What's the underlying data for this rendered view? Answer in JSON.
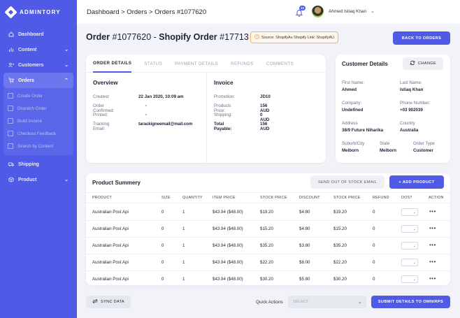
{
  "brand": {
    "name": "ADMINTORY"
  },
  "sidebar": {
    "items": [
      {
        "label": "Dashboard",
        "icon": "home-icon"
      },
      {
        "label": "Content",
        "icon": "bar-chart-icon"
      },
      {
        "label": "Customers",
        "icon": "users-icon"
      },
      {
        "label": "Orders",
        "icon": "cart-icon"
      },
      {
        "label": "Shipping",
        "icon": "truck-icon"
      },
      {
        "label": "Product",
        "icon": "box-icon"
      }
    ],
    "order_sub": [
      "Create Order",
      "Dispatch Order",
      "Build Invoice",
      "Checkout Feedback",
      "Search by Content"
    ]
  },
  "topbar": {
    "breadcrumb": "Dashboard > Orders > Orders #1077620",
    "notification_count": "12",
    "username": "Ahmed Istiaq Khan"
  },
  "header": {
    "title_prefix": "Order",
    "order_id": "#1077620",
    "sep": "-",
    "shopify_label": "Shopify Order",
    "shopify_id": "#17713",
    "source": "Source: ShopifyAu Shopify Link: ShopifyAU",
    "back_label": "BACK TO ORDERS"
  },
  "order_tabs": [
    "ORDER DETAILS",
    "STATUS",
    "PAYMENT DETAILS",
    "REFUNDS",
    "COMMENTS"
  ],
  "overview": {
    "title": "Overview",
    "rows": [
      {
        "k": "Created:",
        "v": "22 Jan 2020, 10:09 am"
      },
      {
        "k": "Order Confirmed:",
        "v": "-"
      },
      {
        "k": "Printed:",
        "v": "-"
      },
      {
        "k": "Tracking Email:",
        "v": "tarackigneemail@mail.com"
      }
    ]
  },
  "invoice": {
    "title": "Invoice",
    "rows": [
      {
        "k": "Promotion:",
        "v": "JD10"
      },
      {
        "k": "Products Price:",
        "v": "156 AUD"
      },
      {
        "k": "Shipping:",
        "v": "0 AUD"
      },
      {
        "k": "Total Payable:",
        "v": "156 AUD"
      }
    ]
  },
  "customer": {
    "title": "Customer Details",
    "change_label": "CHANGE",
    "first_name": {
      "label": "First Name:",
      "value": "Ahmed"
    },
    "last_name": {
      "label": "Last Name:",
      "value": "Istiaq Khan"
    },
    "company": {
      "label": "Company:",
      "value": "Undefined"
    },
    "phone": {
      "label": "Phone Number:",
      "value": "+03 902039"
    },
    "address": {
      "label": "Address",
      "value": "38/9 Future Niharika"
    },
    "country": {
      "label": "Country",
      "value": "Australia"
    },
    "suburb": {
      "label": "Suburb/City",
      "value": "Melborn"
    },
    "state": {
      "label": "State",
      "value": "Melborn"
    },
    "order_type": {
      "label": "Order Type",
      "value": "Customer"
    }
  },
  "products": {
    "title": "Product Summery",
    "stock_email_label": "SEND OUT OF STOCK EMAIL",
    "add_label": "+ ADD PRODUCT",
    "columns": [
      "PRODUCT",
      "SIZE",
      "QUANTITY",
      "ITEM PRICE",
      "STOCK PRICE",
      "DISCOUNT",
      "STOCK PRICE",
      "REFUND",
      "DOS?",
      "ACTION"
    ],
    "rows": [
      [
        "Australian Post Api",
        "0",
        "1",
        "$43.94 ($48.00)",
        "$19.20",
        "$4.80",
        "$19.20",
        "0"
      ],
      [
        "Australian Post Api",
        "0",
        "1",
        "$43.94 ($48.00)",
        "$15.20",
        "$4.80",
        "$15.20",
        "0"
      ],
      [
        "Australian Post Api",
        "0",
        "1",
        "$43.94 ($48.00)",
        "$35.20",
        "$3.80",
        "$35.20",
        "0"
      ],
      [
        "Australian Post Api",
        "0",
        "1",
        "$43.94 ($48.00)",
        "$22.20",
        "$8.00",
        "$22.20",
        "0"
      ],
      [
        "Australian Post Api",
        "0",
        "1",
        "$43.94 ($48.00)",
        "$30.20",
        "$5.80",
        "$30.20",
        "0"
      ]
    ],
    "action_glyph": "•••"
  },
  "footer": {
    "sync_label": "SYNC DATA",
    "quick_actions_label": "Quick Actions",
    "select_placeholder": "SELECT",
    "submit_label": "SUBMIT DETAILS TO OMNIRPS"
  },
  "colors": {
    "accent": "#4f5be6",
    "warning": "#f3b16a"
  }
}
